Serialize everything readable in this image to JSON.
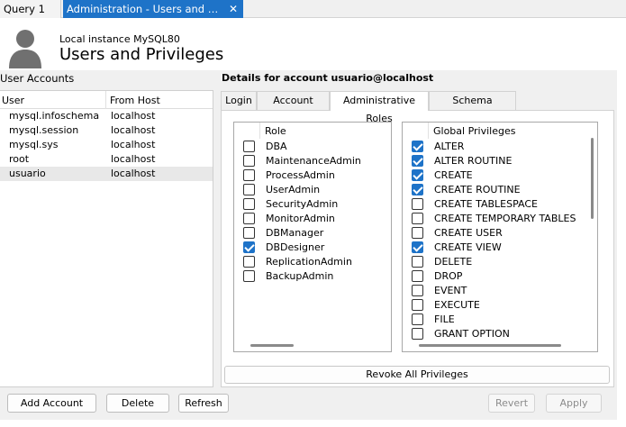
{
  "tabs": [
    {
      "label": "Query 1"
    },
    {
      "label": "Administration - Users and Privileges"
    }
  ],
  "header": {
    "instance": "Local instance MySQL80",
    "title": "Users and Privileges"
  },
  "user_accounts": {
    "label": "User Accounts",
    "columns": [
      "User",
      "From Host"
    ],
    "rows": [
      {
        "user": "mysql.infoschema",
        "host": "localhost"
      },
      {
        "user": "mysql.session",
        "host": "localhost"
      },
      {
        "user": "mysql.sys",
        "host": "localhost"
      },
      {
        "user": "root",
        "host": "localhost"
      },
      {
        "user": "usuario",
        "host": "localhost"
      }
    ]
  },
  "details": {
    "title": "Details for account usuario@localhost",
    "tabs": [
      "Login",
      "Account Limits",
      "Administrative Roles",
      "Schema Privileges"
    ],
    "active_tab": "Administrative Roles",
    "roles_header": "Role",
    "roles": [
      {
        "name": "DBA",
        "checked": false
      },
      {
        "name": "MaintenanceAdmin",
        "checked": false
      },
      {
        "name": "ProcessAdmin",
        "checked": false
      },
      {
        "name": "UserAdmin",
        "checked": false
      },
      {
        "name": "SecurityAdmin",
        "checked": false
      },
      {
        "name": "MonitorAdmin",
        "checked": false
      },
      {
        "name": "DBManager",
        "checked": false
      },
      {
        "name": "DBDesigner",
        "checked": true
      },
      {
        "name": "ReplicationAdmin",
        "checked": false
      },
      {
        "name": "BackupAdmin",
        "checked": false
      }
    ],
    "privs_header": "Global Privileges",
    "privileges": [
      {
        "name": "ALTER",
        "checked": true
      },
      {
        "name": "ALTER ROUTINE",
        "checked": true
      },
      {
        "name": "CREATE",
        "checked": true
      },
      {
        "name": "CREATE ROUTINE",
        "checked": true
      },
      {
        "name": "CREATE TABLESPACE",
        "checked": false
      },
      {
        "name": "CREATE TEMPORARY TABLES",
        "checked": false
      },
      {
        "name": "CREATE USER",
        "checked": false
      },
      {
        "name": "CREATE VIEW",
        "checked": true
      },
      {
        "name": "DELETE",
        "checked": false
      },
      {
        "name": "DROP",
        "checked": false
      },
      {
        "name": "EVENT",
        "checked": false
      },
      {
        "name": "EXECUTE",
        "checked": false
      },
      {
        "name": "FILE",
        "checked": false
      },
      {
        "name": "GRANT OPTION",
        "checked": false
      }
    ],
    "revoke_label": "Revoke All Privileges"
  },
  "buttons": {
    "add_account": "Add Account",
    "delete": "Delete",
    "refresh": "Refresh",
    "revert": "Revert",
    "apply": "Apply"
  },
  "colors": {
    "accent": "#1e73c8"
  }
}
